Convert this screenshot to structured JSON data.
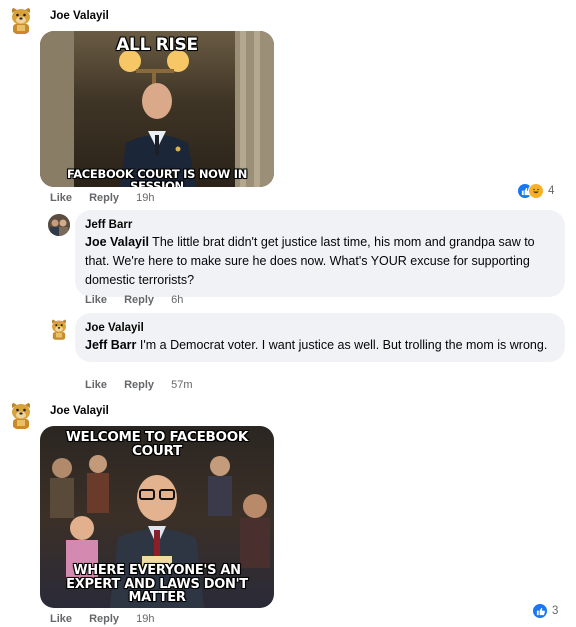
{
  "comments": [
    {
      "author": "Joe Valayil",
      "meme": {
        "top": "ALL RISE",
        "bottom": "FACEBOOK COURT IS NOW IN SESSION"
      },
      "actions": {
        "like": "Like",
        "reply": "Reply",
        "time": "19h"
      },
      "reactions": {
        "icons": [
          "like-icon",
          "haha-icon"
        ],
        "count": "4"
      }
    },
    {
      "author": "Joe Valayil",
      "meme": {
        "top": "WELCOME TO FACEBOOK COURT",
        "bottom": "WHERE EVERYONE'S AN EXPERT AND LAWS DON'T MATTER"
      },
      "actions": {
        "like": "Like",
        "reply": "Reply",
        "time": "19h"
      },
      "reactions": {
        "icons": [
          "like-icon"
        ],
        "count": "3"
      }
    }
  ],
  "replies": [
    {
      "author": "Jeff Barr",
      "mention": "Joe Valayil",
      "text": " The little brat didn't get justice last time, his mom and grandpa saw to that. We're here to make sure he does now. What's YOUR excuse for supporting domestic terrorists?",
      "actions": {
        "like": "Like",
        "reply": "Reply",
        "time": "6h"
      }
    },
    {
      "author": "Joe Valayil",
      "mention": "Jeff Barr",
      "text": " I'm a Democrat voter. I want justice as well. But trolling the mom is wrong.",
      "actions": {
        "like": "Like",
        "reply": "Reply",
        "time": "57m"
      }
    }
  ],
  "colors": {
    "like_blue": "#1877f2",
    "haha_yellow": "#f7b125",
    "bubble_bg": "#f0f2f5",
    "meta_gray": "#65676b"
  }
}
